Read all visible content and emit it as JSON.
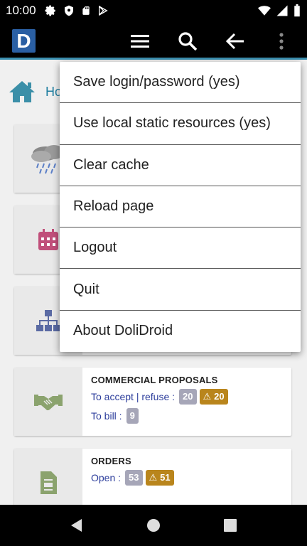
{
  "status_bar": {
    "time": "10:00"
  },
  "app_bar": {
    "logo_letter": "D"
  },
  "breadcrumb": {
    "text": "Ho"
  },
  "menu": {
    "items": [
      "Save login/password (yes)",
      "Use local static resources (yes)",
      "Clear cache",
      "Reload page",
      "Logout",
      "Quit",
      "About DoliDroid"
    ]
  },
  "cards": {
    "proposals": {
      "title": "COMMERCIAL PROPOSALS",
      "line1_label": "To accept | refuse :",
      "line1_count": "20",
      "line1_warn": "20",
      "line2_label": "To bill :",
      "line2_count": "9"
    },
    "orders": {
      "title": "ORDERS",
      "line1_label": "Open :",
      "line1_count": "53",
      "line1_warn": "51"
    }
  },
  "colors": {
    "accent": "#3a8fb0",
    "link": "#2d3e9c",
    "warning": "#b9851c",
    "badge_gray": "#a6a6b8"
  }
}
